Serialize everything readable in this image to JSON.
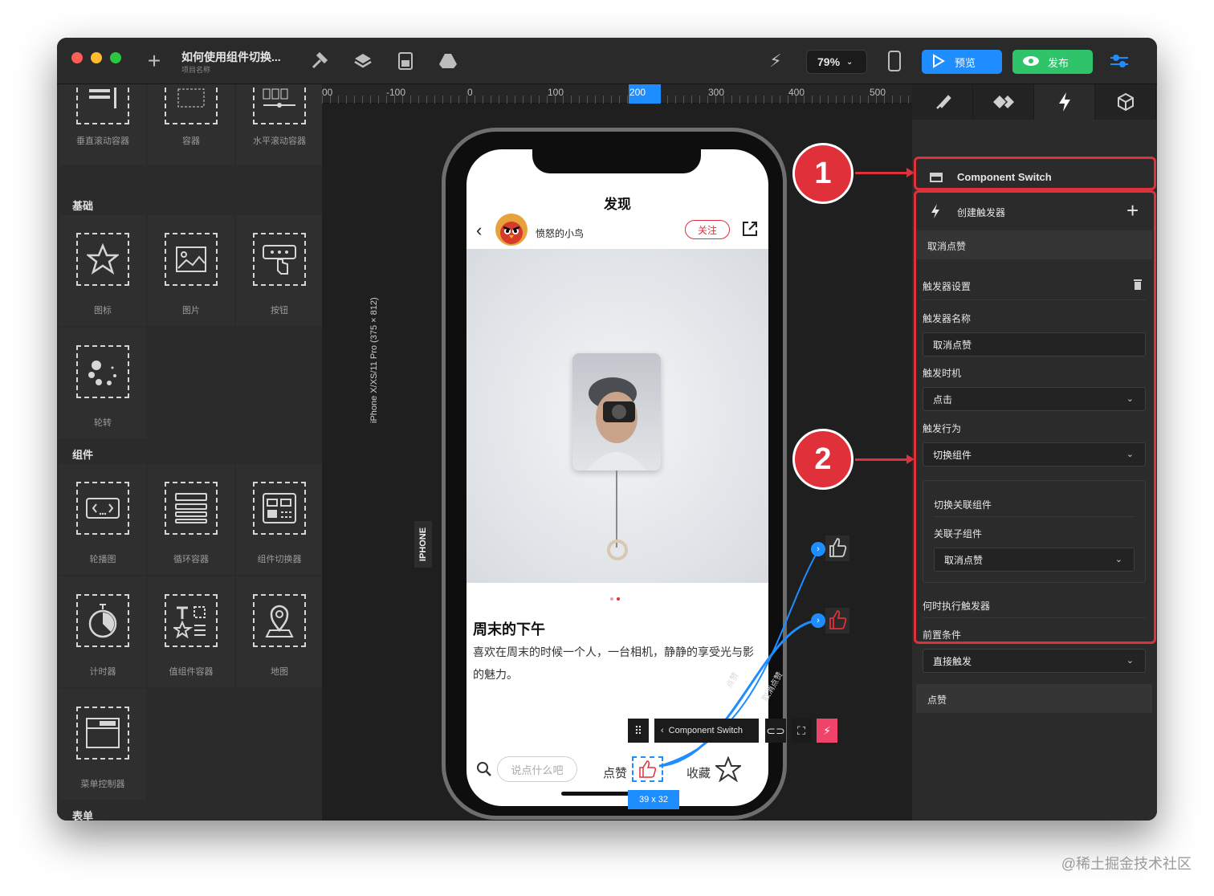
{
  "window": {
    "project_title": "如何使用组件切换...",
    "project_subtitle": "项目名称",
    "zoom": "79%",
    "preview_label": "预览",
    "publish_label": "发布"
  },
  "left_panel": {
    "top_items": [
      "垂直滚动容器",
      "容器",
      "水平滚动容器"
    ],
    "section_basic": "基础",
    "basic_items": [
      "图标",
      "图片",
      "按钮",
      "轮转"
    ],
    "section_components": "组件",
    "component_items": [
      "轮播图",
      "循环容器",
      "组件切换器",
      "计时器",
      "值组件容器",
      "地图",
      "菜单控制器"
    ],
    "section_form": "表单"
  },
  "ruler": {
    "ticks": [
      "00",
      "-100",
      "0",
      "100",
      "200",
      "300",
      "400",
      "500"
    ]
  },
  "canvas": {
    "device_label": "iPhone X/XS/11 Pro (375 × 812)",
    "device_tag": "IPHONE",
    "size_badge": "39 x 32",
    "component_chip": "Component Switch",
    "wire_label_1": "点赞",
    "wire_label_2": "取消点赞"
  },
  "phone": {
    "header_title": "发现",
    "username": "愤怒的小鸟",
    "follow_label": "关注",
    "post_title": "周末的下午",
    "post_body": "喜欢在周末的时候一个人，一台相机，静静的享受光与影的魅力。",
    "comment_placeholder": "说点什么吧",
    "like_label": "点赞",
    "favorite_label": "收藏"
  },
  "callouts": [
    "1",
    "2"
  ],
  "right_panel": {
    "component_name": "Component Switch",
    "create_trigger_label": "创建触发器",
    "trigger_group_1": "取消点赞",
    "trigger_settings": "触发器设置",
    "trigger_name_label": "触发器名称",
    "trigger_name_value": "取消点赞",
    "trigger_timing_label": "触发时机",
    "trigger_timing_value": "点击",
    "trigger_action_label": "触发行为",
    "trigger_action_value": "切换组件",
    "switch_related_label": "切换关联组件",
    "related_child_label": "关联子组件",
    "related_child_value": "取消点赞",
    "when_execute_label": "何时执行触发器",
    "precondition_label": "前置条件",
    "precondition_value": "直接触发",
    "trigger_group_2": "点赞"
  },
  "colors": {
    "accent_blue": "#1e8dff",
    "publish_green": "#2fc36a",
    "highlight_red": "#e0303a",
    "panel_bg": "#2b2b2b"
  },
  "watermark": "@稀土掘金技术社区"
}
